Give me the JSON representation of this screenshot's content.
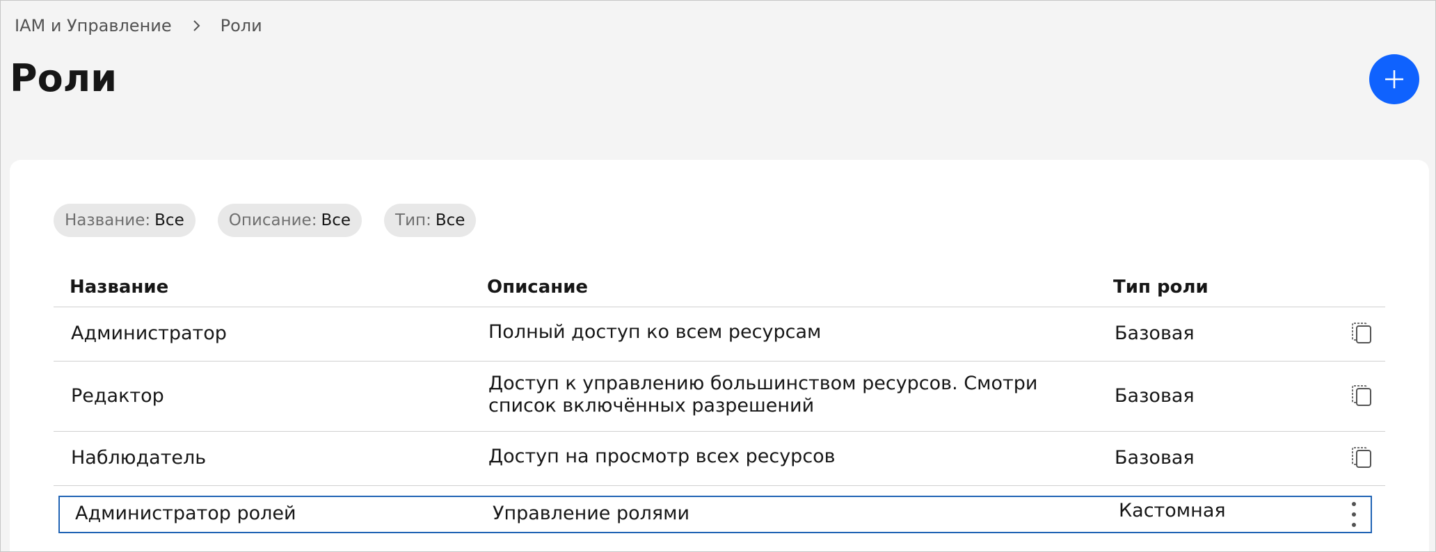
{
  "breadcrumb": {
    "root": "IAM и Управление",
    "current": "Роли"
  },
  "page": {
    "title": "Роли"
  },
  "colors": {
    "accent": "#0f62fe",
    "selected_border": "#1f63b4"
  },
  "filters": [
    {
      "key": "Название:",
      "value": "Все"
    },
    {
      "key": "Описание:",
      "value": "Все"
    },
    {
      "key": "Тип:",
      "value": "Все"
    }
  ],
  "table": {
    "headers": {
      "name": "Название",
      "description": "Описание",
      "type": "Тип роли"
    },
    "rows": [
      {
        "name": "Администратор",
        "description": "Полный доступ ко всем ресурсам",
        "type": "Базовая",
        "action_icon": "copy-icon"
      },
      {
        "name": "Редактор",
        "description_line1": "Доступ к управлению большинством ресурсов. Смотри",
        "description_line2": "список включённых разрешений",
        "type": "Базовая",
        "action_icon": "copy-icon"
      },
      {
        "name": "Наблюдатель",
        "description": "Доступ на просмотр всех ресурсов",
        "type": "Базовая",
        "action_icon": "copy-icon"
      },
      {
        "name": "Администратор ролей",
        "description": "Управление ролями",
        "type": "Кастомная",
        "action_icon": "overflow-menu-icon"
      }
    ]
  }
}
